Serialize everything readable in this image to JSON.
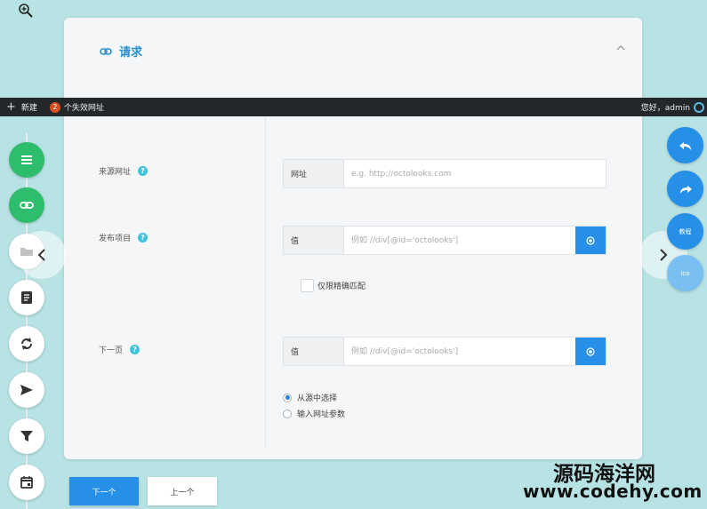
{
  "card": {
    "title": "请求"
  },
  "admin_bar": {
    "new_label": "新建",
    "badge_count": "2",
    "invalid_urls_label": "个失效网址",
    "greeting": "您好，admin"
  },
  "form": {
    "source_url": {
      "label": "来源网址",
      "addon": "网址",
      "placeholder": "e.g. http://octolooks.com"
    },
    "publish_item": {
      "label": "发布项目",
      "addon": "值",
      "placeholder": "例如 //div[@id='octolooks']",
      "exact_match_label": "仅限精确匹配"
    },
    "next_page": {
      "label": "下一页",
      "addon": "值",
      "placeholder": "例如 //div[@id='octolooks']",
      "options": [
        "从源中选择",
        "输入网址参数"
      ],
      "selected_index": 0
    }
  },
  "right_toolbar": {
    "tutorial_label": "教程",
    "faded_label": "ico"
  },
  "buttons": {
    "next": "下一个",
    "previous": "上一个"
  },
  "watermark": {
    "chinese": "源码海洋网",
    "url": "www.codehy.com"
  },
  "colors": {
    "background": "#b8e3e4",
    "primary": "#2690e8",
    "green": "#2ebd6c",
    "admin_bar": "#22272c",
    "help": "#3fc2dd",
    "badge": "#d54e21"
  }
}
